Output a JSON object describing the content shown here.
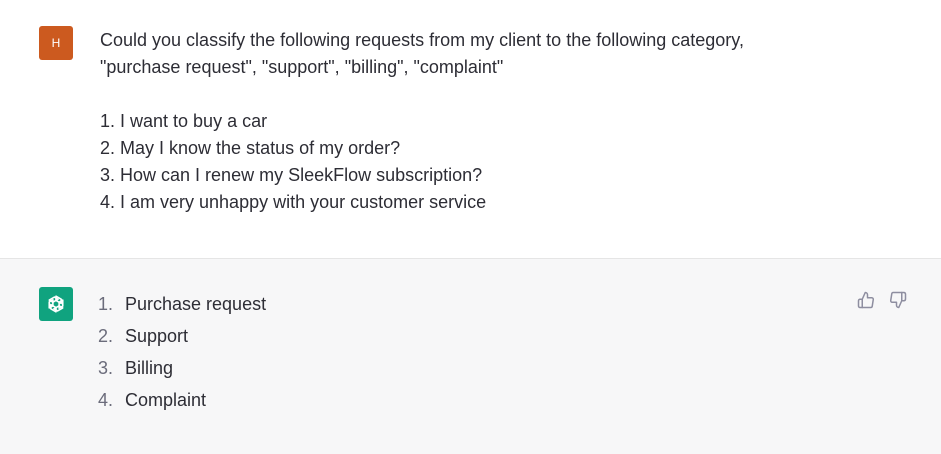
{
  "user": {
    "avatar_initial": "H",
    "avatar_color": "#cc5a1f",
    "lines": [
      "Could you classify the following requests from my client to the following category,",
      "\"purchase request\", \"support\", \"billing\", \"complaint\""
    ],
    "requests": [
      "1. I want to buy a car",
      "2. May I know the status of my order?",
      "3. How can I renew my SleekFlow subscription?",
      "4. I am very unhappy with your customer service"
    ]
  },
  "assistant": {
    "avatar_icon": "openai-logo-icon",
    "avatar_color": "#10a37f",
    "answers": [
      {
        "num": "1.",
        "text": "Purchase request"
      },
      {
        "num": "2.",
        "text": "Support"
      },
      {
        "num": "3.",
        "text": "Billing"
      },
      {
        "num": "4.",
        "text": "Complaint"
      }
    ],
    "feedback_icons": [
      "thumbs-up-icon",
      "thumbs-down-icon"
    ]
  }
}
